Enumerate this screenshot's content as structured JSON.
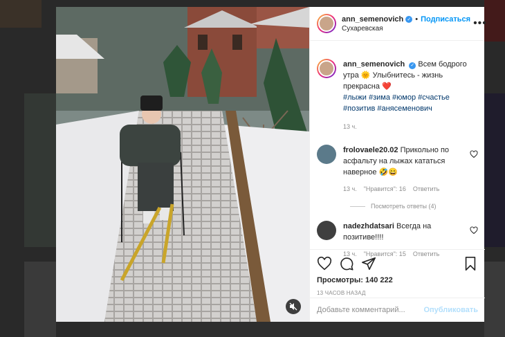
{
  "post": {
    "username": "ann_semenovich",
    "follow_label": "Подписаться",
    "dot": "•",
    "location": "Сухаревская",
    "more_label": "•••"
  },
  "caption": {
    "username": "ann_semenovich",
    "text": "Всем бодрого утра 🌞 Улыбнитесь - жизнь прекрасна ❤️",
    "tags": "#лыжи #зима #юмор #счастье #позитив #анясеменович",
    "time": "13 ч."
  },
  "comments": [
    {
      "username": "frolovaele20.02",
      "text": "Прикольно по асфальту на лыжах кататься наверное 🤣😄",
      "time": "13 ч.",
      "likes": "\"Нравится\": 16",
      "reply": "Ответить",
      "avatar_color": "#5b7a8a"
    },
    {
      "username": "nadezhdatsari",
      "text": "Всегда на позитиве!!!!",
      "time": "13 ч.",
      "likes": "\"Нравится\": 15",
      "reply": "Ответить",
      "avatar_color": "#3f3f3f"
    }
  ],
  "view_replies": "Посмотреть ответы (4)",
  "stats": {
    "views": "Просмотры: 140 222",
    "timestamp": "13 ЧАСОВ НАЗАД"
  },
  "add_comment": {
    "placeholder": "Добавьте комментарий...",
    "publish_label": "Опубликовать"
  },
  "icons": {
    "like": "heart-icon",
    "comment": "comment-icon",
    "share": "share-icon",
    "save": "bookmark-icon",
    "mute": "speaker-muted-icon",
    "verified": "verified-badge-icon"
  },
  "colors": {
    "link_blue": "#0095f6",
    "tag_blue": "#00376b",
    "muted": "#8e8e8e",
    "publish_disabled": "#b2dffc"
  }
}
